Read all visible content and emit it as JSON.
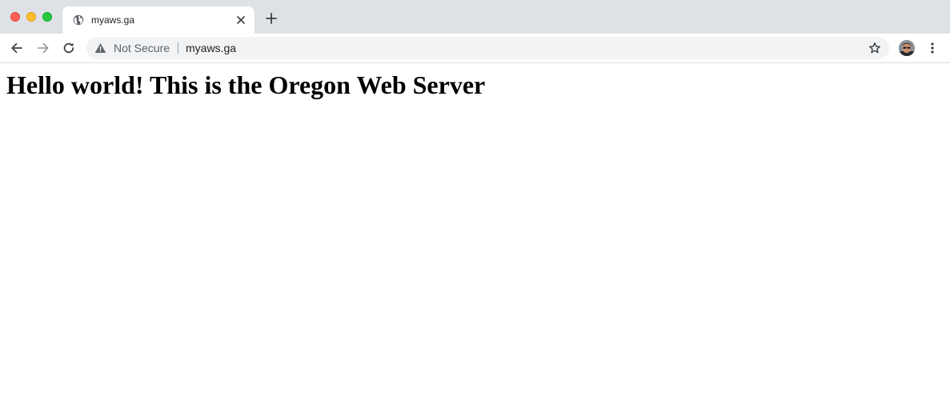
{
  "window": {
    "controls": [
      "close",
      "minimize",
      "maximize"
    ]
  },
  "tab": {
    "title": "myaws.ga",
    "favicon": "globe-icon",
    "close_icon": "close-icon"
  },
  "new_tab_icon": "plus-icon",
  "toolbar": {
    "back_icon": "back-arrow-icon",
    "forward_icon": "forward-arrow-icon",
    "reload_icon": "reload-icon",
    "security_icon": "warning-triangle-icon",
    "security_label": "Not Secure",
    "url": "myaws.ga",
    "bookmark_icon": "star-icon",
    "profile_icon": "avatar",
    "menu_icon": "kebab-menu-icon"
  },
  "page": {
    "heading": "Hello world! This is the Oregon Web Server"
  },
  "colors": {
    "tabstrip_bg": "#dee1e6",
    "omnibox_bg": "#f1f3f4",
    "traffic_close": "#ff5f57",
    "traffic_minimize": "#febc2e",
    "traffic_maximize": "#28c840",
    "text_secondary": "#5f6368",
    "text_primary": "#202124"
  }
}
